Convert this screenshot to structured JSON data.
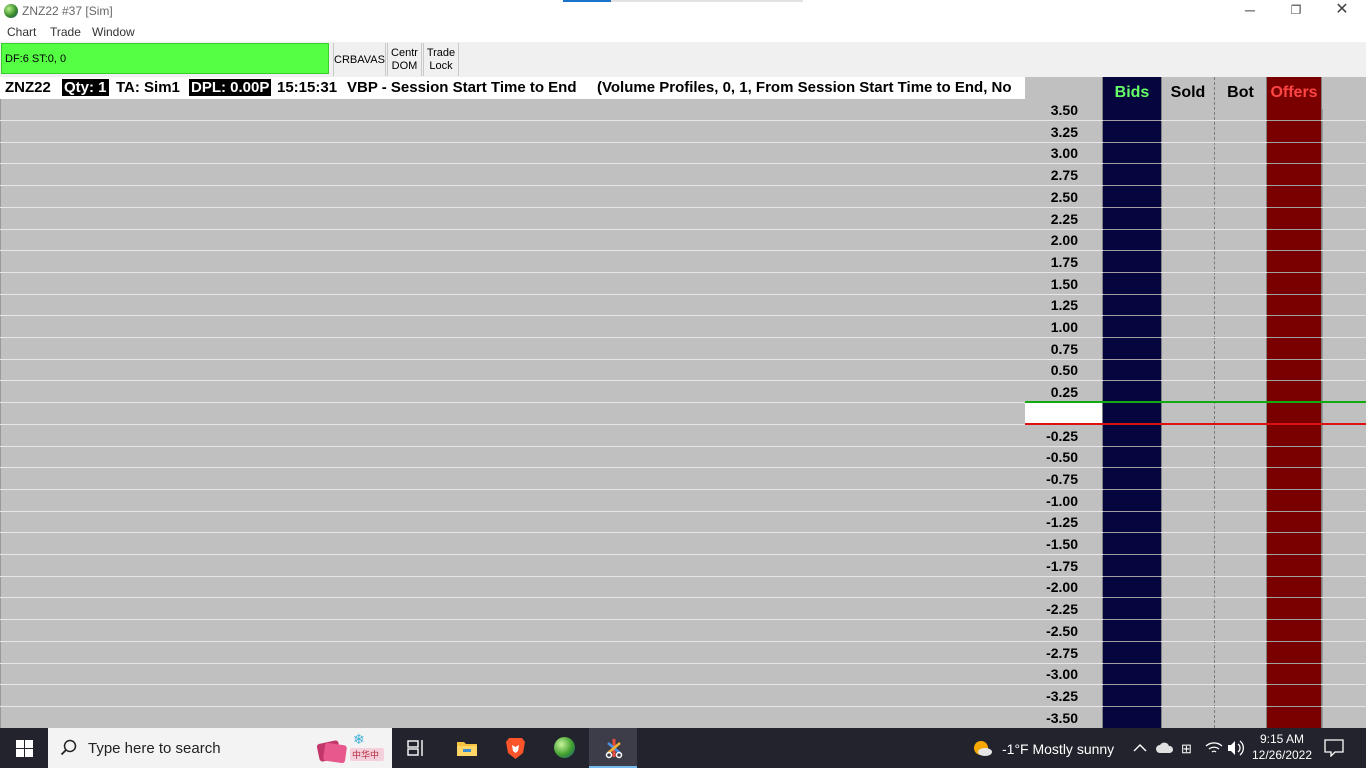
{
  "window": {
    "title": "ZNZ22  #37 [Sim]",
    "minimize": "─",
    "maximize": "❐",
    "close": "✕"
  },
  "menu": [
    "Chart",
    "Trade",
    "Window"
  ],
  "toolbar": {
    "status": "DF:6  ST:0, 0",
    "status_color": "#55ff44",
    "crbavas": "CRBAVAS",
    "centr_dom_line1": "Centr",
    "centr_dom_line2": "DOM",
    "trade_lock_line1": "Trade",
    "trade_lock_line2": "Lock"
  },
  "chart_header": {
    "symbol": "ZNZ22",
    "qty": "Qty: 1",
    "account": "TA: Sim1",
    "dpl": "DPL: 0.00P",
    "time": "15:15:31",
    "study": "VBP - Session Start Time to End",
    "study_params": "(Volume Profiles, 0, 1, From Session Start Time to End, No"
  },
  "dom": {
    "headers": {
      "bids": "Bids",
      "sold": "Sold",
      "bot": "Bot",
      "offers": "Offers"
    },
    "bids_header_color": "#66ff66",
    "offers_header_color": "#ff4444",
    "bids_color": "#06063f",
    "offers_color": "#7a0000",
    "prices": [
      "3.50",
      "3.25",
      "3.00",
      "2.75",
      "2.50",
      "2.25",
      "2.00",
      "1.75",
      "1.50",
      "1.25",
      "1.00",
      "0.75",
      "0.50",
      "0.25",
      "",
      "-0.25",
      "-0.50",
      "-0.75",
      "-1.00",
      "-1.25",
      "-1.50",
      "-1.75",
      "-2.00",
      "-2.25",
      "-2.50",
      "-2.75",
      "-3.00",
      "-3.25",
      "-3.50"
    ]
  },
  "taskbar": {
    "search_placeholder": "Type here to search",
    "weather": "-1°F  Mostly sunny",
    "time": "9:15 AM",
    "date": "12/26/2022",
    "icons": [
      "start-icon",
      "search-icon",
      "task-view-icon",
      "file-explorer-icon",
      "brave-browser-icon",
      "sierra-chart-icon",
      "snipping-tool-icon",
      "weather-icon",
      "chevron-up-icon",
      "cloud-icon",
      "ime-icon",
      "wifi-icon",
      "volume-icon",
      "notifications-icon"
    ]
  }
}
